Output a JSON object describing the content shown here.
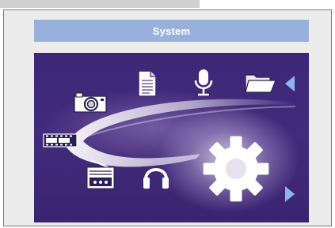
{
  "panel": {
    "title": "System"
  },
  "menu": {
    "selected": "settings",
    "items": [
      {
        "icon": "file-icon"
      },
      {
        "icon": "microphone-icon"
      },
      {
        "icon": "folder-icon"
      },
      {
        "icon": "camera-icon"
      },
      {
        "icon": "film-strip-icon"
      },
      {
        "icon": "radio-icon"
      },
      {
        "icon": "headphones-icon"
      },
      {
        "icon": "gear-icon"
      }
    ]
  },
  "colors": {
    "title_bar": "#98b1dc",
    "screen_bg": "#3c2877",
    "arrow": "#8fb4e6"
  }
}
